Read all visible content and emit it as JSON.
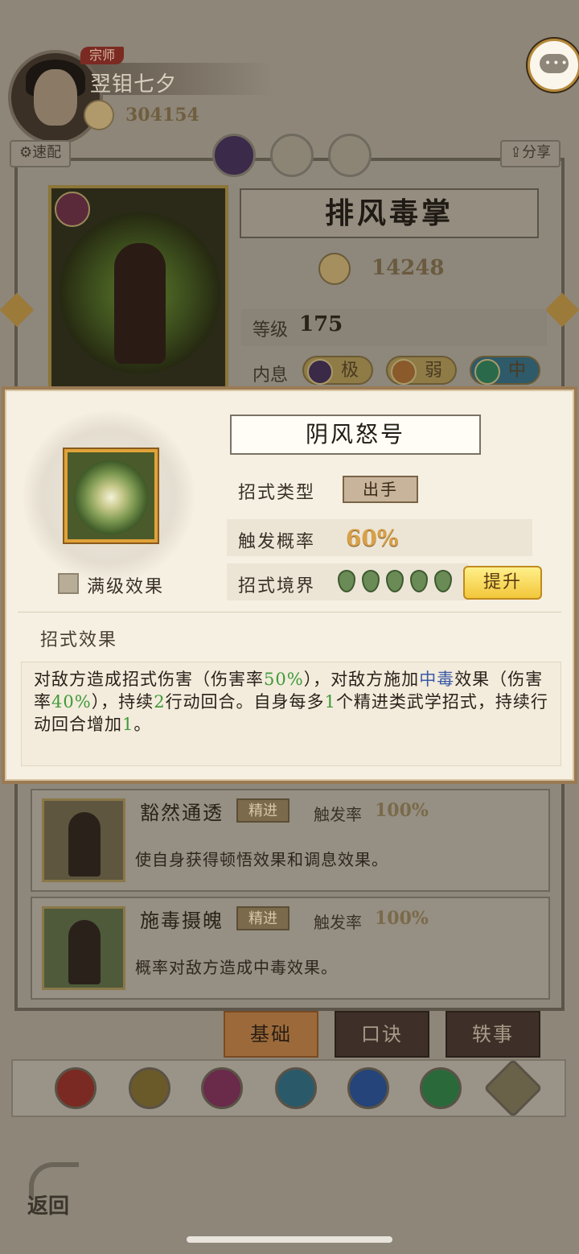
{
  "player": {
    "rank_badge": "宗师",
    "name": "翌钼七夕",
    "power": "304154"
  },
  "top_bar": {
    "quick_config_label": "速配",
    "share_label": "分享"
  },
  "skill_card": {
    "title": "排风毒掌",
    "power": "14248",
    "level_label": "等级",
    "level_value": "175",
    "inner_label": "内息",
    "inner_values": [
      "极",
      "弱",
      "中"
    ]
  },
  "popup": {
    "title": "阴风怒号",
    "type_label": "招式类型",
    "type_value": "出手",
    "trigger_label": "触发概率",
    "trigger_value": "60%",
    "realm_label": "招式境界",
    "realm_level": 5,
    "upgrade_label": "提升",
    "max_level_label": "满级效果",
    "effect_section_label": "招式效果",
    "description": {
      "p1": "对敌方造成招式伤害（伤害率",
      "v1": "50%",
      "p2": "），对敌方施加",
      "link": "中毒",
      "p3": "效果（伤害率",
      "v2": "40%",
      "p4": "），持续",
      "v3": "2",
      "p5": "行动回合。自身每多",
      "v4": "1",
      "p6": "个精进类武学招式，持续行动回合增加",
      "v5": "1",
      "p7": "。"
    }
  },
  "lower_skills": [
    {
      "name": "豁然通透",
      "tag": "精进",
      "rate_label": "触发率",
      "rate": "100%",
      "desc": "使自身获得顿悟效果和调息效果。"
    },
    {
      "name": "施毒摄魄",
      "tag": "精进",
      "rate_label": "触发率",
      "rate": "100%",
      "desc": "概率对敌方造成中毒效果。"
    }
  ],
  "tabs": [
    "基础",
    "口诀",
    "轶事"
  ],
  "back_label": "返回",
  "colors": {
    "accent_gold": "#f2c63a",
    "highlight_green": "#3f9a3a",
    "highlight_blue": "#3a5aa8",
    "popup_bg": "#f6f0e2"
  }
}
